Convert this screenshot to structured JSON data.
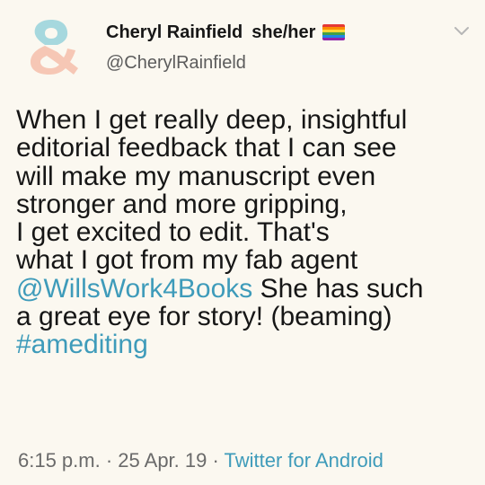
{
  "author": {
    "name": "Cheryl Rainfield",
    "pronouns": "she/her",
    "handle": "@CherylRainfield",
    "badge_icon": "rainbow-pride-flag-icon",
    "avatar_icon": "ampersand-logo-icon"
  },
  "tweet": {
    "lines": [
      "When I get really deep, insightful",
      "editorial feedback that I can see",
      "will make my manuscript even",
      "stronger and more gripping,",
      "I get excited to edit. That's",
      "what I got from my fab agent"
    ],
    "mention": "@WillsWork4Books",
    "after_mention": " She has such",
    "line8": "a great eye for story! (beaming)",
    "hashtag": "#amediting"
  },
  "meta": {
    "time": "6:15 p.m.",
    "sep1": " · ",
    "date": "25 Apr. 19",
    "sep2": " · ",
    "source": "Twitter for Android"
  },
  "colors": {
    "background": "#fbf8f0",
    "link": "#3e9bba",
    "secondary_text": "#6a6a6a",
    "avatar_teal": "#a6d8de",
    "avatar_peach": "#f6c7b5"
  }
}
